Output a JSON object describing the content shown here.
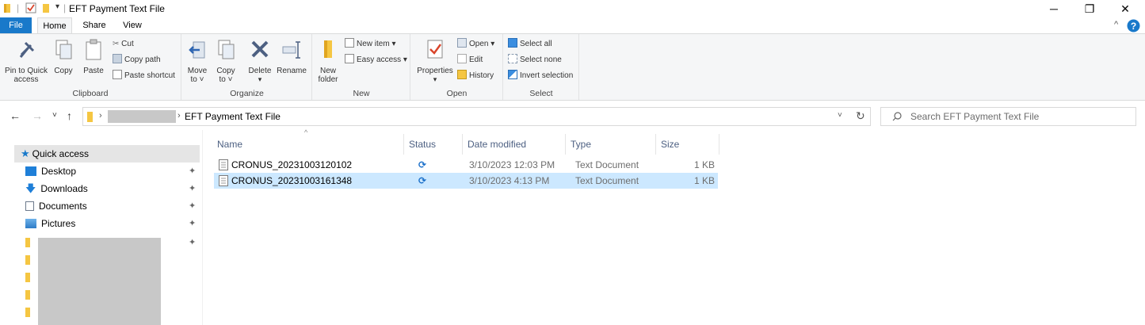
{
  "window": {
    "title": "EFT Payment Text File",
    "controls": {
      "minimize": "─",
      "maximize": "❐",
      "close": "✕"
    }
  },
  "tabs": [
    {
      "label": "File"
    },
    {
      "label": "Home"
    },
    {
      "label": "Share"
    },
    {
      "label": "View"
    }
  ],
  "ribbon": {
    "clipboard": {
      "label": "Clipboard",
      "pin_label_1": "Pin to Quick",
      "pin_label_2": "access",
      "copy": "Copy",
      "paste": "Paste",
      "cut": "Cut",
      "copy_path": "Copy path",
      "paste_shortcut": "Paste shortcut"
    },
    "organize": {
      "label": "Organize",
      "move_to_1": "Move",
      "move_to_2": "to ˅",
      "copy_to_1": "Copy",
      "copy_to_2": "to ˅",
      "delete": "Delete",
      "rename": "Rename"
    },
    "new": {
      "label": "New",
      "new_folder_1": "New",
      "new_folder_2": "folder",
      "new_item": "New item ▾",
      "easy_access": "Easy access ▾"
    },
    "open": {
      "label": "Open",
      "properties": "Properties",
      "open": "Open ▾",
      "edit": "Edit",
      "history": "History"
    },
    "select": {
      "label": "Select",
      "select_all": "Select all",
      "select_none": "Select none",
      "invert": "Invert selection"
    }
  },
  "address": {
    "current": "EFT Payment Text File",
    "search_placeholder": "Search EFT Payment Text File"
  },
  "navpane": {
    "quick_access": "Quick access",
    "items": [
      {
        "label": "Desktop"
      },
      {
        "label": "Downloads"
      },
      {
        "label": "Documents"
      },
      {
        "label": "Pictures"
      }
    ]
  },
  "columns": {
    "name": "Name",
    "status": "Status",
    "date_modified": "Date modified",
    "type": "Type",
    "size": "Size"
  },
  "files": [
    {
      "name": "CRONUS_20231003120102",
      "date": "3/10/2023 12:03 PM",
      "type": "Text Document",
      "size": "1 KB",
      "selected": false
    },
    {
      "name": "CRONUS_20231003161348",
      "date": "3/10/2023 4:13 PM",
      "type": "Text Document",
      "size": "1 KB",
      "selected": true
    }
  ],
  "colors": {
    "accent": "#1979ca",
    "selection": "#cce8ff",
    "folder": "#f5c642",
    "sync": "#1a6fc9"
  }
}
